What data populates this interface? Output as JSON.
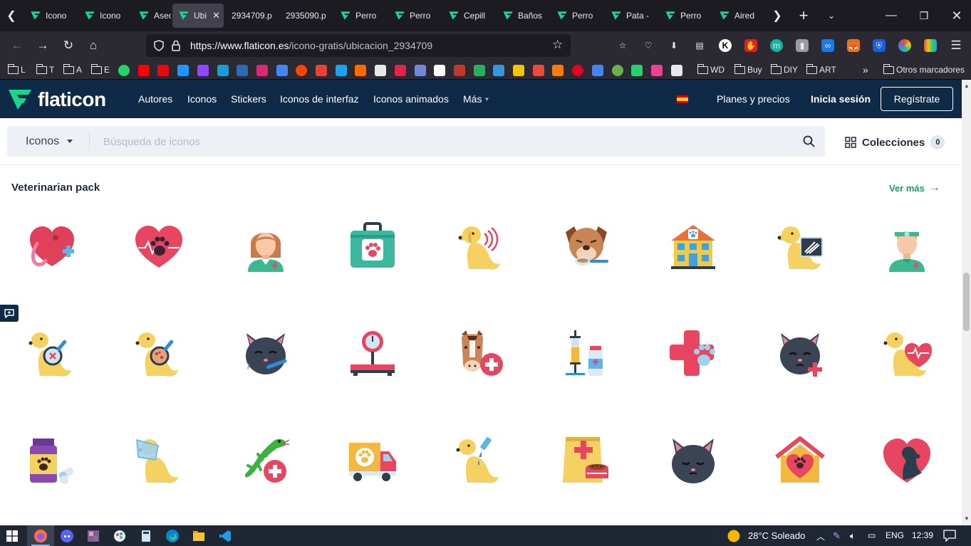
{
  "browser": {
    "tabs": [
      {
        "label": "Icono",
        "type": "flaticon"
      },
      {
        "label": "Icono",
        "type": "flaticon"
      },
      {
        "label": "Aseo -",
        "type": "flaticon"
      },
      {
        "label": "Ubi",
        "type": "flaticon",
        "active": true
      },
      {
        "label": "2934709.p",
        "type": "file"
      },
      {
        "label": "2935090.p",
        "type": "file"
      },
      {
        "label": "Perro",
        "type": "flaticon"
      },
      {
        "label": "Perro",
        "type": "flaticon"
      },
      {
        "label": "Cepill",
        "type": "flaticon"
      },
      {
        "label": "Baños",
        "type": "flaticon"
      },
      {
        "label": "Perro",
        "type": "flaticon"
      },
      {
        "label": "Pata -",
        "type": "flaticon"
      },
      {
        "label": "Perro",
        "type": "flaticon"
      },
      {
        "label": "Aired",
        "type": "flaticon"
      }
    ],
    "url_host": "https://www.flaticon.es",
    "url_path": "/icono-gratis/ubicacion_2934709",
    "bookmarks_folders": [
      "L",
      "T",
      "A",
      "E"
    ],
    "bookmarks_folders_right": [
      "WD",
      "Buy",
      "DIY",
      "ART"
    ],
    "other_bookmarks": "Otros marcadores"
  },
  "site": {
    "logo_text": "flaticon",
    "nav": [
      "Autores",
      "Iconos",
      "Stickers",
      "Iconos de interfaz",
      "Iconos animados",
      "Más"
    ],
    "plans": "Planes y precios",
    "login": "Inicia sesión",
    "signup": "Regístrate",
    "search_type": "Iconos",
    "search_placeholder": "Búsqueda de iconos",
    "collections_label": "Colecciones",
    "collections_count": "0",
    "section_title": "Veterinarian pack",
    "see_more": "Ver más",
    "accent": "#129d6c",
    "header_bg": "#0e2a47"
  },
  "icons": [
    "heart-bandage-icon",
    "heart-paw-icon",
    "veterinarian-woman-icon",
    "first-aid-kit-paw-icon",
    "dog-hearing-icon",
    "dog-feeding-spoon-icon",
    "vet-clinic-building-icon",
    "dog-xray-icon",
    "veterinarian-man-icon",
    "dog-magnifier-icon",
    "dog-magnifier-bacteria-icon",
    "sick-cat-thermometer-icon",
    "weight-scale-icon",
    "horse-medical-icon",
    "syringe-medicine-icon",
    "medical-cross-paw-icon",
    "sick-cat-cross-icon",
    "dog-heartbeat-icon",
    "medicine-bottle-pills-icon",
    "dog-cone-collar-icon",
    "lizard-medical-icon",
    "pet-ambulance-truck-icon",
    "dog-drops-icon",
    "pet-food-bag-icon",
    "cat-face-icon",
    "pet-house-heart-icon",
    "heart-dog-silhouette-icon"
  ],
  "taskbar": {
    "weather": "28°C  Soleado",
    "lang": "ENG",
    "time": "12:39"
  }
}
